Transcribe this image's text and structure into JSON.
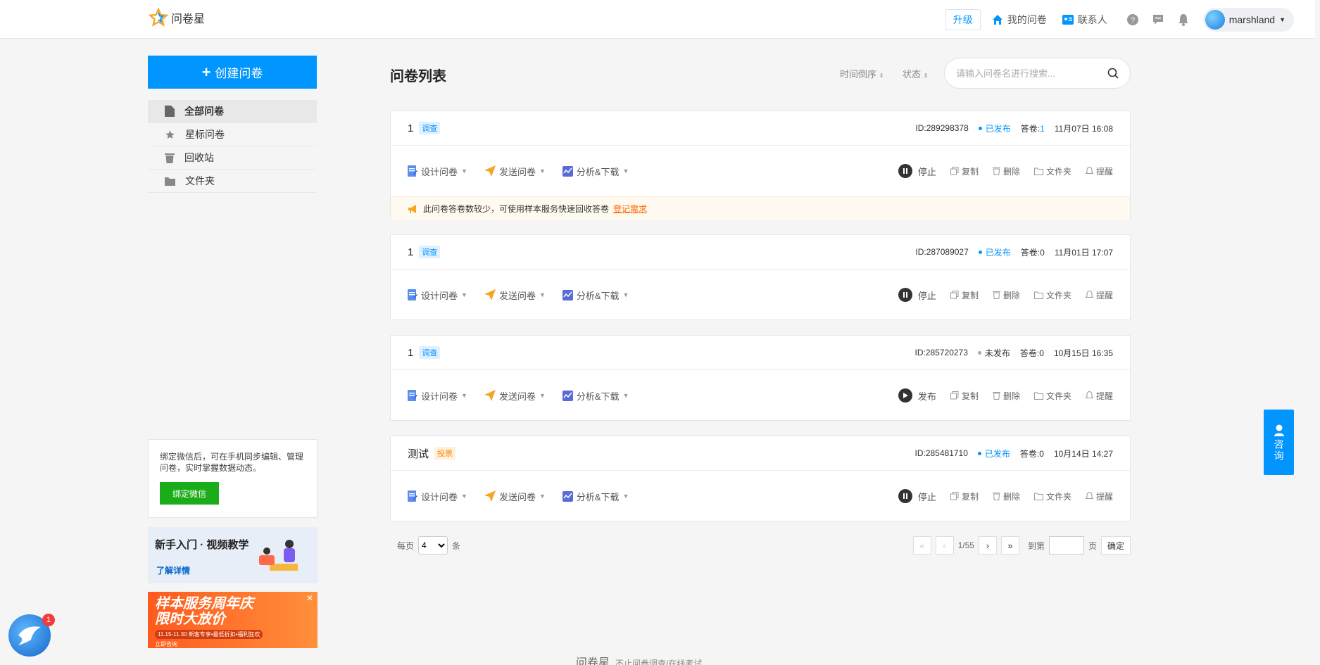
{
  "header": {
    "brand": "问卷星",
    "upgrade": "升级",
    "my_surveys": "我的问卷",
    "contacts": "联系人",
    "username": "marshland"
  },
  "sidebar": {
    "create_label": "创建问卷",
    "items": [
      {
        "label": "全部问卷",
        "icon": "document-icon"
      },
      {
        "label": "星标问卷",
        "icon": "star-icon"
      },
      {
        "label": "回收站",
        "icon": "trash-icon"
      },
      {
        "label": "文件夹",
        "icon": "folder-icon"
      }
    ],
    "wechat_text": "绑定微信后，可在手机同步编辑、管理问卷，实时掌握数据动态。",
    "wechat_button": "绑定微信",
    "tutorial_title": "新手入门 · 视频教学",
    "tutorial_link": "了解详情",
    "promo_line1": "样本服务周年庆",
    "promo_line2": "限时大放价",
    "promo_sub": "11.15-11.30 新客专享•最低折扣•福利狂欢",
    "promo_small": "立即咨询"
  },
  "main": {
    "title": "问卷列表",
    "sort_label": "时间倒序",
    "status_label": "状态",
    "search_placeholder": "请输入问卷名进行搜索...",
    "action_design": "设计问卷",
    "action_send": "发送问卷",
    "action_analyze": "分析&下载",
    "copy": "复制",
    "delete": "删除",
    "folder": "文件夹",
    "remind": "提醒",
    "cards": [
      {
        "name": "1",
        "tag": "调查",
        "id": "ID:289298378",
        "status": "已发布",
        "answers_label": "答卷:",
        "answers": "1",
        "date": "11月07日 16:08",
        "toggle": "停止",
        "notice": "此问卷答卷数较少，可使用样本服务快速回收答卷",
        "notice_link": "登记需求"
      },
      {
        "name": "1",
        "tag": "调查",
        "id": "ID:287089027",
        "status": "已发布",
        "answers_label": "答卷:",
        "answers": "0",
        "date": "11月01日 17:07",
        "toggle": "停止"
      },
      {
        "name": "1",
        "tag": "调查",
        "id": "ID:285720273",
        "status": "未发布",
        "answers_label": "答卷:",
        "answers": "0",
        "date": "10月15日 16:35",
        "toggle": "发布"
      },
      {
        "name": "测试",
        "tag": "投票",
        "id": "ID:285481710",
        "status": "已发布",
        "answers_label": "答卷:",
        "answers": "0",
        "date": "10月14日 14:27",
        "toggle": "停止"
      }
    ]
  },
  "pagination": {
    "per_page_prefix": "每页",
    "per_page_value": "4",
    "per_page_suffix": "条",
    "page_info": "1/55",
    "goto_prefix": "到第",
    "goto_suffix": "页",
    "confirm": "确定"
  },
  "footer": {
    "brand": "问卷星",
    "slogan": "不止问卷调查/在线考试"
  },
  "consult": "咨询",
  "chat_badge": "1",
  "colors": {
    "primary": "#0095ff",
    "wechat": "#1aad19",
    "promo": "#ff5a1f",
    "notice_link": "#ff6600"
  }
}
